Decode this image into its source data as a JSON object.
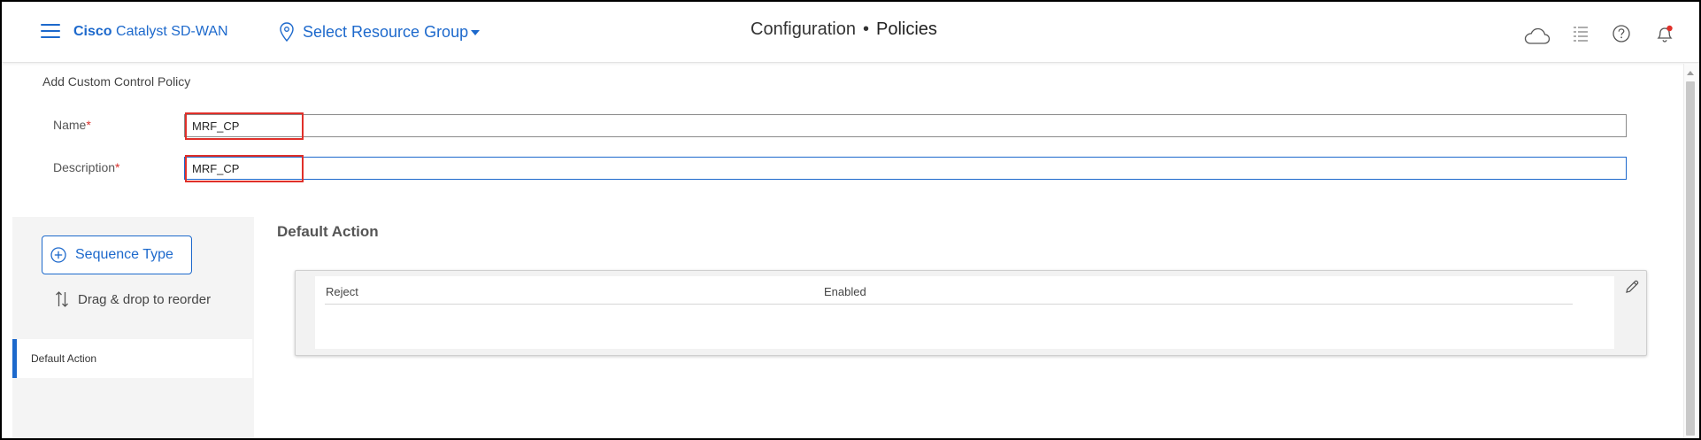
{
  "header": {
    "brand_bold": "Cisco",
    "brand_rest": " Catalyst SD-WAN",
    "resource_group_label": "Select Resource Group",
    "title_section": "Configuration",
    "title_separator": "•",
    "title_page": "Policies",
    "icons": [
      "menu-icon",
      "location-pin-icon",
      "cloud-icon",
      "task-list-icon",
      "help-icon",
      "notification-bell-icon"
    ],
    "notification_dot_color": "#e0302a"
  },
  "form": {
    "subtitle": "Add Custom Control Policy",
    "name_label": "Name",
    "name_value": "MRF_CP",
    "description_label": "Description",
    "description_value": "MRF_CP",
    "required_marker": "*"
  },
  "sidebar": {
    "sequence_type_label": "Sequence Type",
    "drag_hint": "Drag & drop to reorder",
    "items": [
      {
        "label": "Default Action",
        "selected": true
      }
    ]
  },
  "main": {
    "section_title": "Default Action",
    "action": {
      "type": "Reject",
      "status": "Enabled"
    }
  },
  "colors": {
    "accent": "#1d69cc",
    "highlight_box": "#e0302a",
    "required": "#d9302c"
  }
}
